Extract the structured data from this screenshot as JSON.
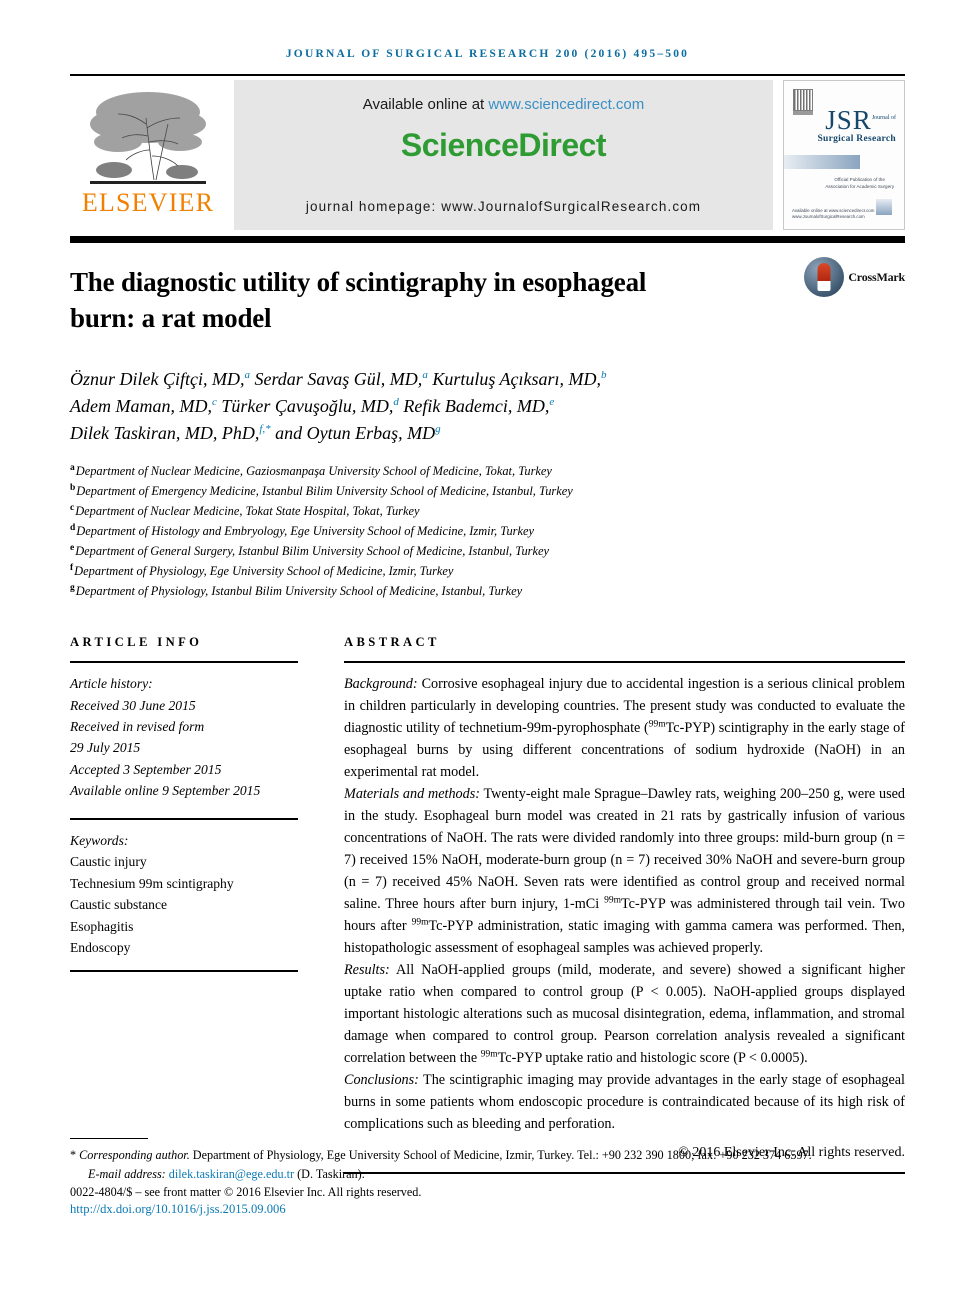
{
  "running_head": "JOURNAL OF SURGICAL RESEARCH 200 (2016) 495–500",
  "masthead": {
    "publisher": "ELSEVIER",
    "available_text": "Available online at ",
    "available_link": "www.sciencedirect.com",
    "sciencedirect_logo": "ScienceDirect",
    "journal_homepage": "journal homepage: www.JournalofSurgicalResearch.com",
    "cover": {
      "title": "JSR",
      "title_sup": "Journal of",
      "subtitle": "Surgical Research",
      "assoc_line1": "Official Publication of the",
      "assoc_line2": "Association for Academic Surgery",
      "url_line1": "Available online at www.sciencedirect.com",
      "url_line2": "www.JournalofSurgicalResearch.com"
    }
  },
  "title": "The diagnostic utility of scintigraphy in esophageal burn: a rat model",
  "crossmark_label": "CrossMark",
  "authors_lines": [
    [
      {
        "name": "Öznur Dilek Çiftçi, MD,",
        "sup": "a"
      },
      {
        "name": " Serdar Savaş Gül, MD,",
        "sup": "a"
      },
      {
        "name": " Kurtuluş Açıksarı, MD,",
        "sup": "b"
      }
    ],
    [
      {
        "name": "Adem Maman, MD,",
        "sup": "c"
      },
      {
        "name": " Türker Çavuşoğlu, MD,",
        "sup": "d"
      },
      {
        "name": " Refik Bademci, MD,",
        "sup": "e"
      }
    ],
    [
      {
        "name": "Dilek Taskiran, MD, PhD,",
        "sup": "f,*"
      },
      {
        "name": " and Oytun Erbaş, MD",
        "sup": "g"
      }
    ]
  ],
  "affiliations": [
    {
      "mark": "a",
      "text": "Department of Nuclear Medicine, Gaziosmanpaşa University School of Medicine, Tokat, Turkey"
    },
    {
      "mark": "b",
      "text": "Department of Emergency Medicine, Istanbul Bilim University School of Medicine, Istanbul, Turkey"
    },
    {
      "mark": "c",
      "text": "Department of Nuclear Medicine, Tokat State Hospital, Tokat, Turkey"
    },
    {
      "mark": "d",
      "text": "Department of Histology and Embryology, Ege University School of Medicine, Izmir, Turkey"
    },
    {
      "mark": "e",
      "text": "Department of General Surgery, Istanbul Bilim University School of Medicine, Istanbul, Turkey"
    },
    {
      "mark": "f",
      "text": "Department of Physiology, Ege University School of Medicine, Izmir, Turkey"
    },
    {
      "mark": "g",
      "text": "Department of Physiology, Istanbul Bilim University School of Medicine, Istanbul, Turkey"
    }
  ],
  "article_info": {
    "heading": "ARTICLE INFO",
    "history_label": "Article history:",
    "history": [
      "Received 30 June 2015",
      "Received in revised form",
      "29 July 2015",
      "Accepted 3 September 2015",
      "Available online 9 September 2015"
    ],
    "keywords_label": "Keywords:",
    "keywords": [
      "Caustic injury",
      "Technesium 99m scintigraphy",
      "Caustic substance",
      "Esophagitis",
      "Endoscopy"
    ]
  },
  "abstract": {
    "heading": "ABSTRACT",
    "sections": [
      {
        "label": "Background:",
        "text": " Corrosive esophageal injury due to accidental ingestion is a serious clinical problem in children particularly in developing countries. The present study was conducted to evaluate the diagnostic utility of technetium-99m-pyrophosphate (99mTc-PYP) scintigraphy in the early stage of esophageal burns by using different concentrations of sodium hydroxide (NaOH) in an experimental rat model."
      },
      {
        "label": "Materials and methods:",
        "text": " Twenty-eight male Sprague–Dawley rats, weighing 200–250 g, were used in the study. Esophageal burn model was created in 21 rats by gastrically infusion of various concentrations of NaOH. The rats were divided randomly into three groups: mild-burn group (n = 7) received 15% NaOH, moderate-burn group (n = 7) received 30% NaOH and severe-burn group (n = 7) received 45% NaOH. Seven rats were identified as control group and received normal saline. Three hours after burn injury, 1-mCi 99mTc-PYP was administered through tail vein. Two hours after 99mTc-PYP administration, static imaging with gamma camera was performed. Then, histopathologic assessment of esophageal samples was achieved properly."
      },
      {
        "label": "Results:",
        "text": " All NaOH-applied groups (mild, moderate, and severe) showed a significant higher uptake ratio when compared to control group (P < 0.005). NaOH-applied groups displayed important histologic alterations such as mucosal disintegration, edema, inflammation, and stromal damage when compared to control group. Pearson correlation analysis revealed a significant correlation between the 99mTc-PYP uptake ratio and histologic score (P < 0.0005)."
      },
      {
        "label": "Conclusions:",
        "text": " The scintigraphic imaging may provide advantages in the early stage of esophageal burns in some patients whom endoscopic procedure is contraindicated because of its high risk of complications such as bleeding and perforation."
      }
    ],
    "copyright": "© 2016 Elsevier Inc. All rights reserved."
  },
  "footnotes": {
    "corresponding_mark": "*",
    "corresponding_label": "Corresponding author.",
    "corresponding_text": " Department of Physiology, Ege University School of Medicine, Izmir, Turkey. Tel.: +90 232 390 1800; fax: +90 232 374 6597.",
    "email_label": "E-mail address: ",
    "email": "dilek.taskiran@ege.edu.tr",
    "email_suffix": " (D. Taskiran).",
    "issn_line": "0022-4804/$ – see front matter © 2016 Elsevier Inc. All rights reserved.",
    "doi": "http://dx.doi.org/10.1016/j.jss.2015.09.006"
  },
  "colors": {
    "running_head": "#0b6ca0",
    "link": "#0b7ab5",
    "sciencedirect_green": "#2e9b33",
    "elsevier_orange": "#F08000",
    "sd_panel": "#e6e6e6"
  }
}
